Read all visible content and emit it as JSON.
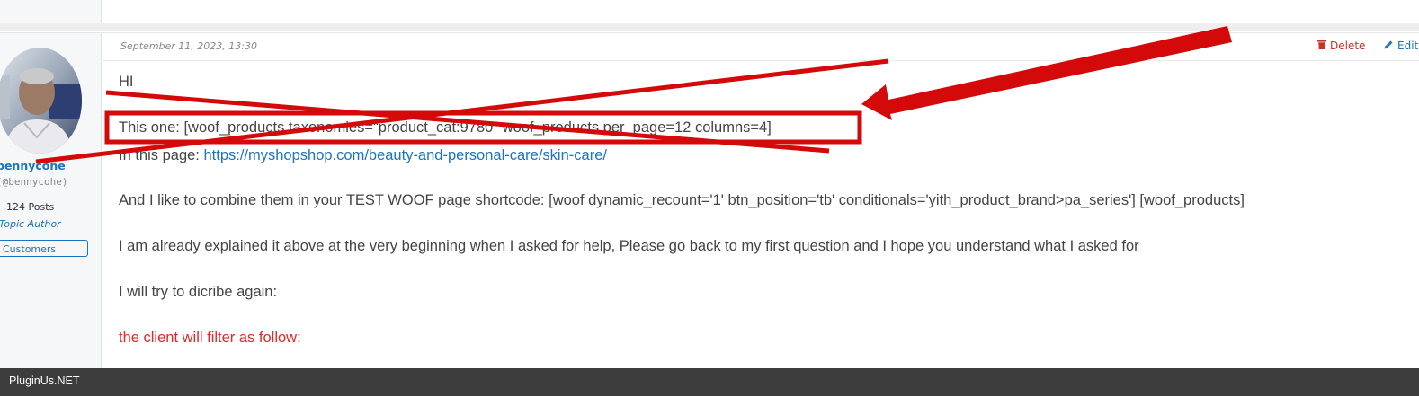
{
  "author": {
    "name": "bennycone",
    "handle": "(@bennycohe)",
    "posts": "124 Posts",
    "role": "Topic Author",
    "badge": "Customers"
  },
  "post": {
    "date": "September 11, 2023, 13:30",
    "actions": {
      "delete": "Delete",
      "edit": "Edit"
    },
    "paragraphs": {
      "greeting": "HI",
      "this_one": "This one: [woof_products taxonomies=\"product_cat:9780\" woof_products per_page=12 columns=4]",
      "in_page_prefix": "In this page: ",
      "in_page_link": "https://myshopshop.com/beauty-and-personal-care/skin-care/",
      "combine": "And I like to combine them in your TEST WOOF page shortcode: [woof dynamic_recount='1' btn_position='tb' conditionals='yith_product_brand>pa_series'] [woof_products]",
      "explained": "I am already explained it above at the very beginning when I asked for help, Please go back to my first question and I hope you understand what I asked for",
      "try_again": "I will try to dicribe again:",
      "filter_follow": "the client will filter as follow:"
    }
  },
  "footer": {
    "site": "PluginUs.NET"
  },
  "colors": {
    "accent": "#1e73be",
    "annotation": "#d40a0a",
    "danger": "#c8322b",
    "footer_bg": "#3d3d3d"
  },
  "icons": {
    "delete": "trash-icon",
    "edit": "pencil-icon"
  }
}
